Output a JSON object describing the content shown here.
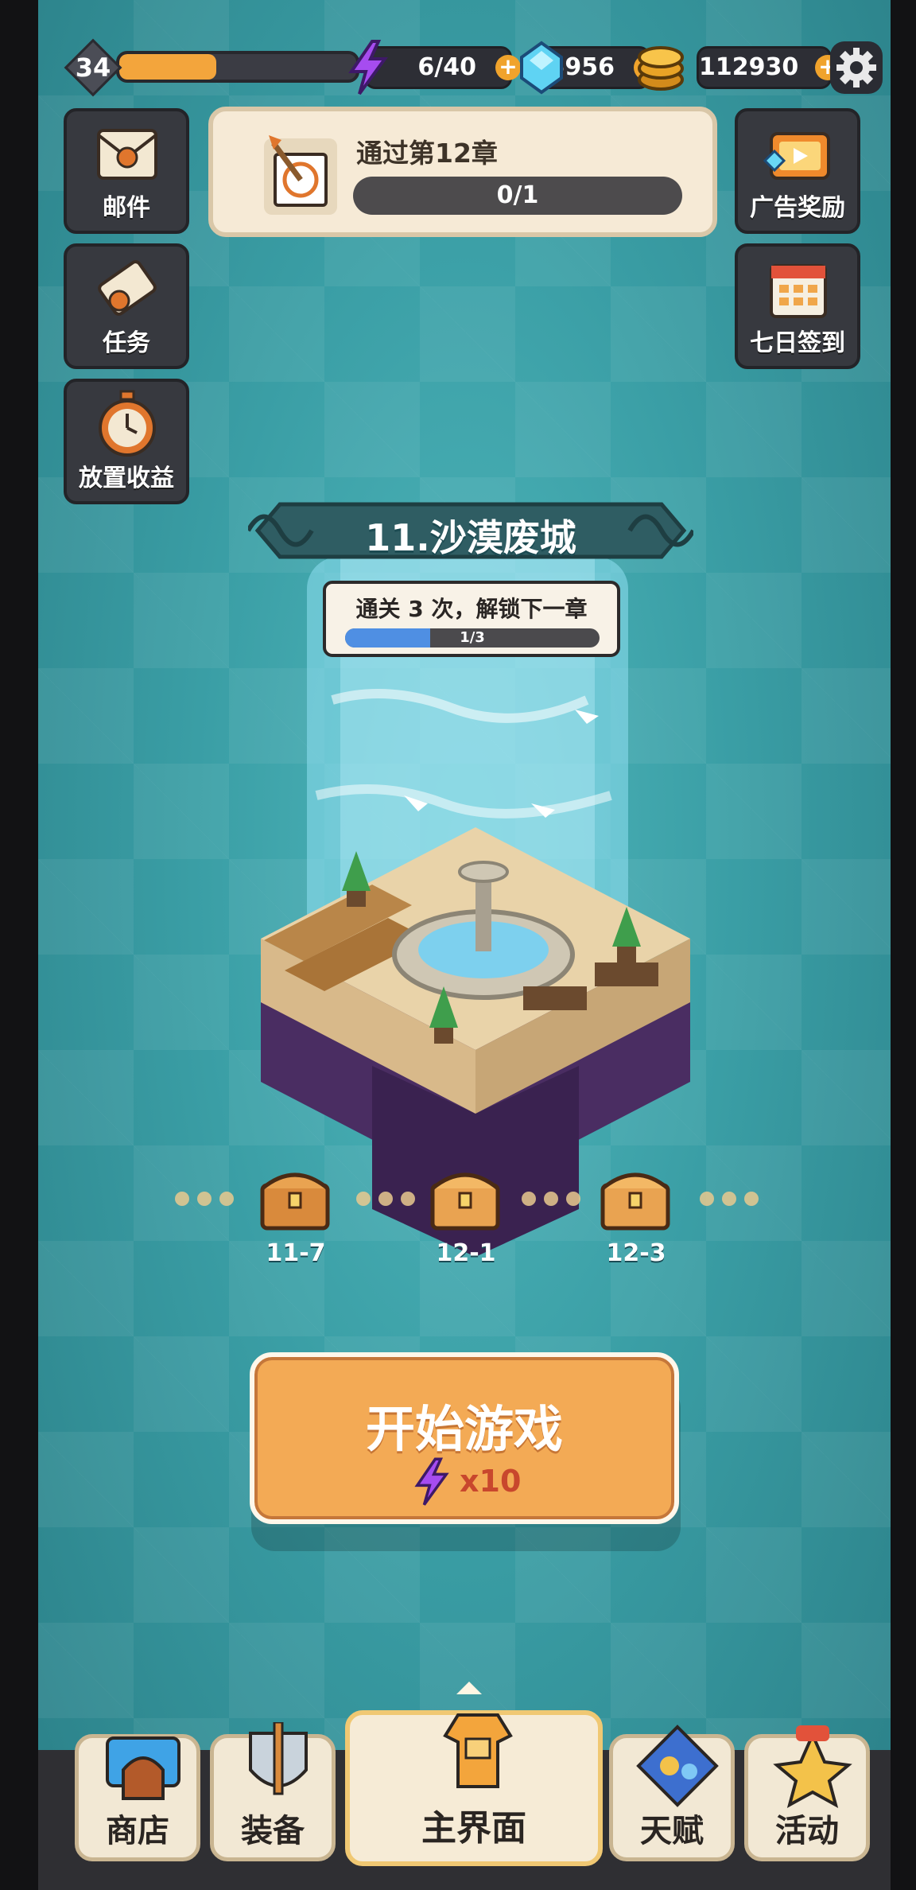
{
  "player": {
    "level": "34",
    "xp_progress": 0.41
  },
  "resources": {
    "energy": "6/40",
    "gems": "5956",
    "gold": "112930"
  },
  "side_left": [
    {
      "label": "邮件"
    },
    {
      "label": "任务"
    },
    {
      "label": "放置收益"
    }
  ],
  "side_right": [
    {
      "label": "广告奖励"
    },
    {
      "label": "七日签到"
    }
  ],
  "quest": {
    "title": "通过第12章",
    "progress_text": "0/1",
    "progress": 0.0
  },
  "chapter": {
    "name": "11.沙漠废城",
    "unlock_tip": "通关 3 次，解锁下一章",
    "unlock_progress_text": "1/3",
    "unlock_progress": 0.3333
  },
  "stages": [
    {
      "label": "11-7"
    },
    {
      "label": "12-1"
    },
    {
      "label": "12-3"
    }
  ],
  "start_button": {
    "label": "开始游戏",
    "cost": "x10"
  },
  "bottom_nav": [
    {
      "label": "商店"
    },
    {
      "label": "装备"
    },
    {
      "label": "主界面"
    },
    {
      "label": "天赋"
    },
    {
      "label": "活动"
    }
  ],
  "colors": {
    "accent_orange": "#f3aa55",
    "energy_purple": "#a64cf0",
    "gem_blue": "#5fd3f3",
    "gold_yellow": "#f2b233",
    "background_teal": "#3a9ea5"
  },
  "icons": [
    "lightning-icon",
    "gem-icon",
    "gold-coin-icon",
    "gear-icon",
    "mail-icon",
    "scroll-icon",
    "stopwatch-icon",
    "ad-reward-icon",
    "calendar-icon",
    "quest-target-icon",
    "treasure-chest-icon",
    "shop-icon",
    "sword-shield-icon",
    "armor-icon",
    "talent-icon",
    "activity-icon"
  ]
}
